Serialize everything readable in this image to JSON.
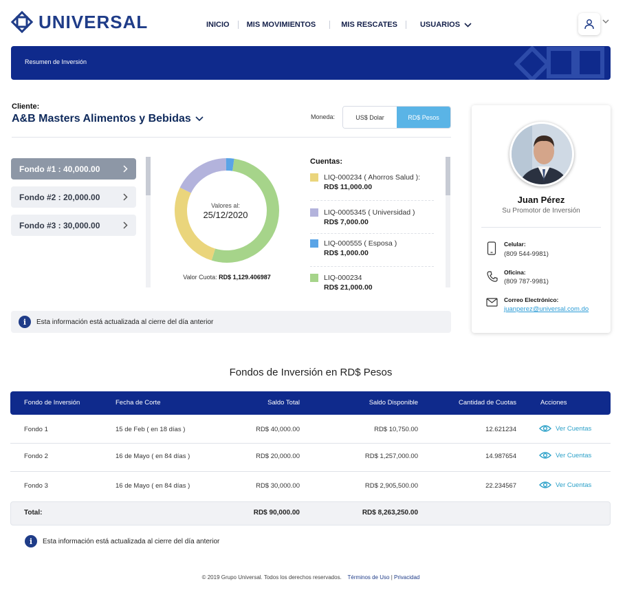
{
  "brand": {
    "name": "UNIVERSAL"
  },
  "nav": {
    "inicio": "INICIO",
    "movimientos": "MIS MOVIMIENTOS",
    "rescates": "MIS RESCATES",
    "usuarios": "USUARIOS"
  },
  "banner": {
    "title": "Resumen de Inversión"
  },
  "client": {
    "label": "Cliente:",
    "name": "A&B Masters Alimentos y Bebidas"
  },
  "currency": {
    "label": "Moneda:",
    "options": [
      "US$ Dolar",
      "RD$ Pesos"
    ],
    "selected": "RD$ Pesos"
  },
  "funds": [
    {
      "label": "Fondo #1 : 40,000.00",
      "active": true
    },
    {
      "label": "Fondo #2 : 20,000.00",
      "active": false
    },
    {
      "label": "Fondo #3 : 30,000.00",
      "active": false
    }
  ],
  "donut": {
    "center_label": "Valores al:",
    "center_date": "25/12/2020",
    "valor_cuota_label": "Valor Cuota:",
    "valor_cuota_value": "RD$ 1,129.406987"
  },
  "accounts": {
    "title": "Cuentas:",
    "items": [
      {
        "name": "LIQ-000234 ( Ahorros Salud ):",
        "amount": "RD$ 11,000.00",
        "value": 11000,
        "color": "#ead57c"
      },
      {
        "name": "LIQ-0005345 ( Universidad )",
        "amount": "RD$ 7,000.00",
        "value": 7000,
        "color": "#b3b3dc"
      },
      {
        "name": "LIQ-000555 ( Esposa )",
        "amount": "RD$ 1,000.00",
        "value": 1000,
        "color": "#5aa4e6"
      },
      {
        "name": "LIQ-000234",
        "amount": "RD$ 21,000.00",
        "value": 21000,
        "color": "#a6d48a"
      }
    ]
  },
  "info_note": "Esta información está actualizada al cierre del día anterior",
  "promoter": {
    "name": "Juan Pérez",
    "role": "Su Promotor de Inversión",
    "cell_label": "Celular:",
    "cell": "(809 544-9981)",
    "office_label": "Oficina:",
    "office": "(809 787-9981)",
    "email_label": "Correo Electrónico:",
    "email": "juanperez@universal.com.do"
  },
  "table": {
    "title": "Fondos de Inversión en RD$ Pesos",
    "headers": [
      "Fondo de Inversión",
      "Fecha de Corte",
      "Saldo Total",
      "Saldo Disponible",
      "Cantidad de Cuotas",
      "Acciones"
    ],
    "rows": [
      {
        "fondo": "Fondo 1",
        "fecha": "15 de Feb ( en 18 días )",
        "total": "RD$ 40,000.00",
        "disponible": "RD$ 10,750.00",
        "cuotas": "12.621234",
        "accion": "Ver Cuentas"
      },
      {
        "fondo": "Fondo 2",
        "fecha": "16 de Mayo ( en 84 días )",
        "total": "RD$ 20,000.00",
        "disponible": "RD$ 1,257,000.00",
        "cuotas": "14.987654",
        "accion": "Ver Cuentas"
      },
      {
        "fondo": "Fondo 3",
        "fecha": "16 de Mayo ( en 84 días )",
        "total": "RD$ 30,000.00",
        "disponible": "RD$ 2,905,500.00",
        "cuotas": "22.234567",
        "accion": "Ver Cuentas"
      }
    ],
    "total_label": "Total:",
    "total_saldo": "RD$ 90,000.00",
    "total_disponible": "RD$ 8,263,250.00"
  },
  "footer": {
    "copyright": "© 2019 Grupo Universal. Todos los derechos reservados.",
    "terms": "Términos de Uso",
    "sep": "|",
    "privacy": "Privacidad"
  }
}
